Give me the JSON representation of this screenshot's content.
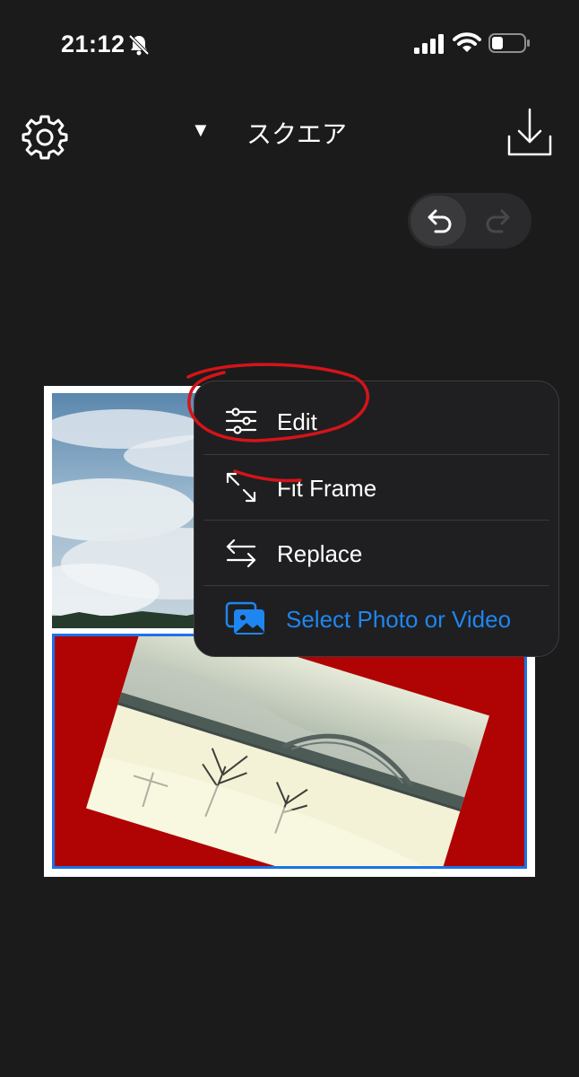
{
  "status_bar": {
    "time": "21:12",
    "icons": [
      "bell-slash-icon",
      "signal-icon",
      "wifi-icon",
      "battery-icon"
    ]
  },
  "nav": {
    "dropdown_arrow": "▼",
    "title": "スクエア",
    "left_icon": "gear-icon",
    "right_icon": "download-icon"
  },
  "history": {
    "undo_icon": "undo-icon",
    "redo_icon": "redo-icon"
  },
  "context_menu": {
    "items": [
      {
        "label": "Edit",
        "icon": "sliders-icon"
      },
      {
        "label": "Fit Frame",
        "icon": "expand-arrows-icon"
      },
      {
        "label": "Replace",
        "icon": "swap-arrows-icon"
      },
      {
        "label": "Select Photo or Video",
        "icon": "photos-icon"
      }
    ]
  },
  "colors": {
    "background": "#1b1b1c",
    "accent_blue": "#1e86f0",
    "frame_red": "#b00303",
    "selection_blue": "#1a73e8",
    "annotation_red": "#d4141a"
  }
}
